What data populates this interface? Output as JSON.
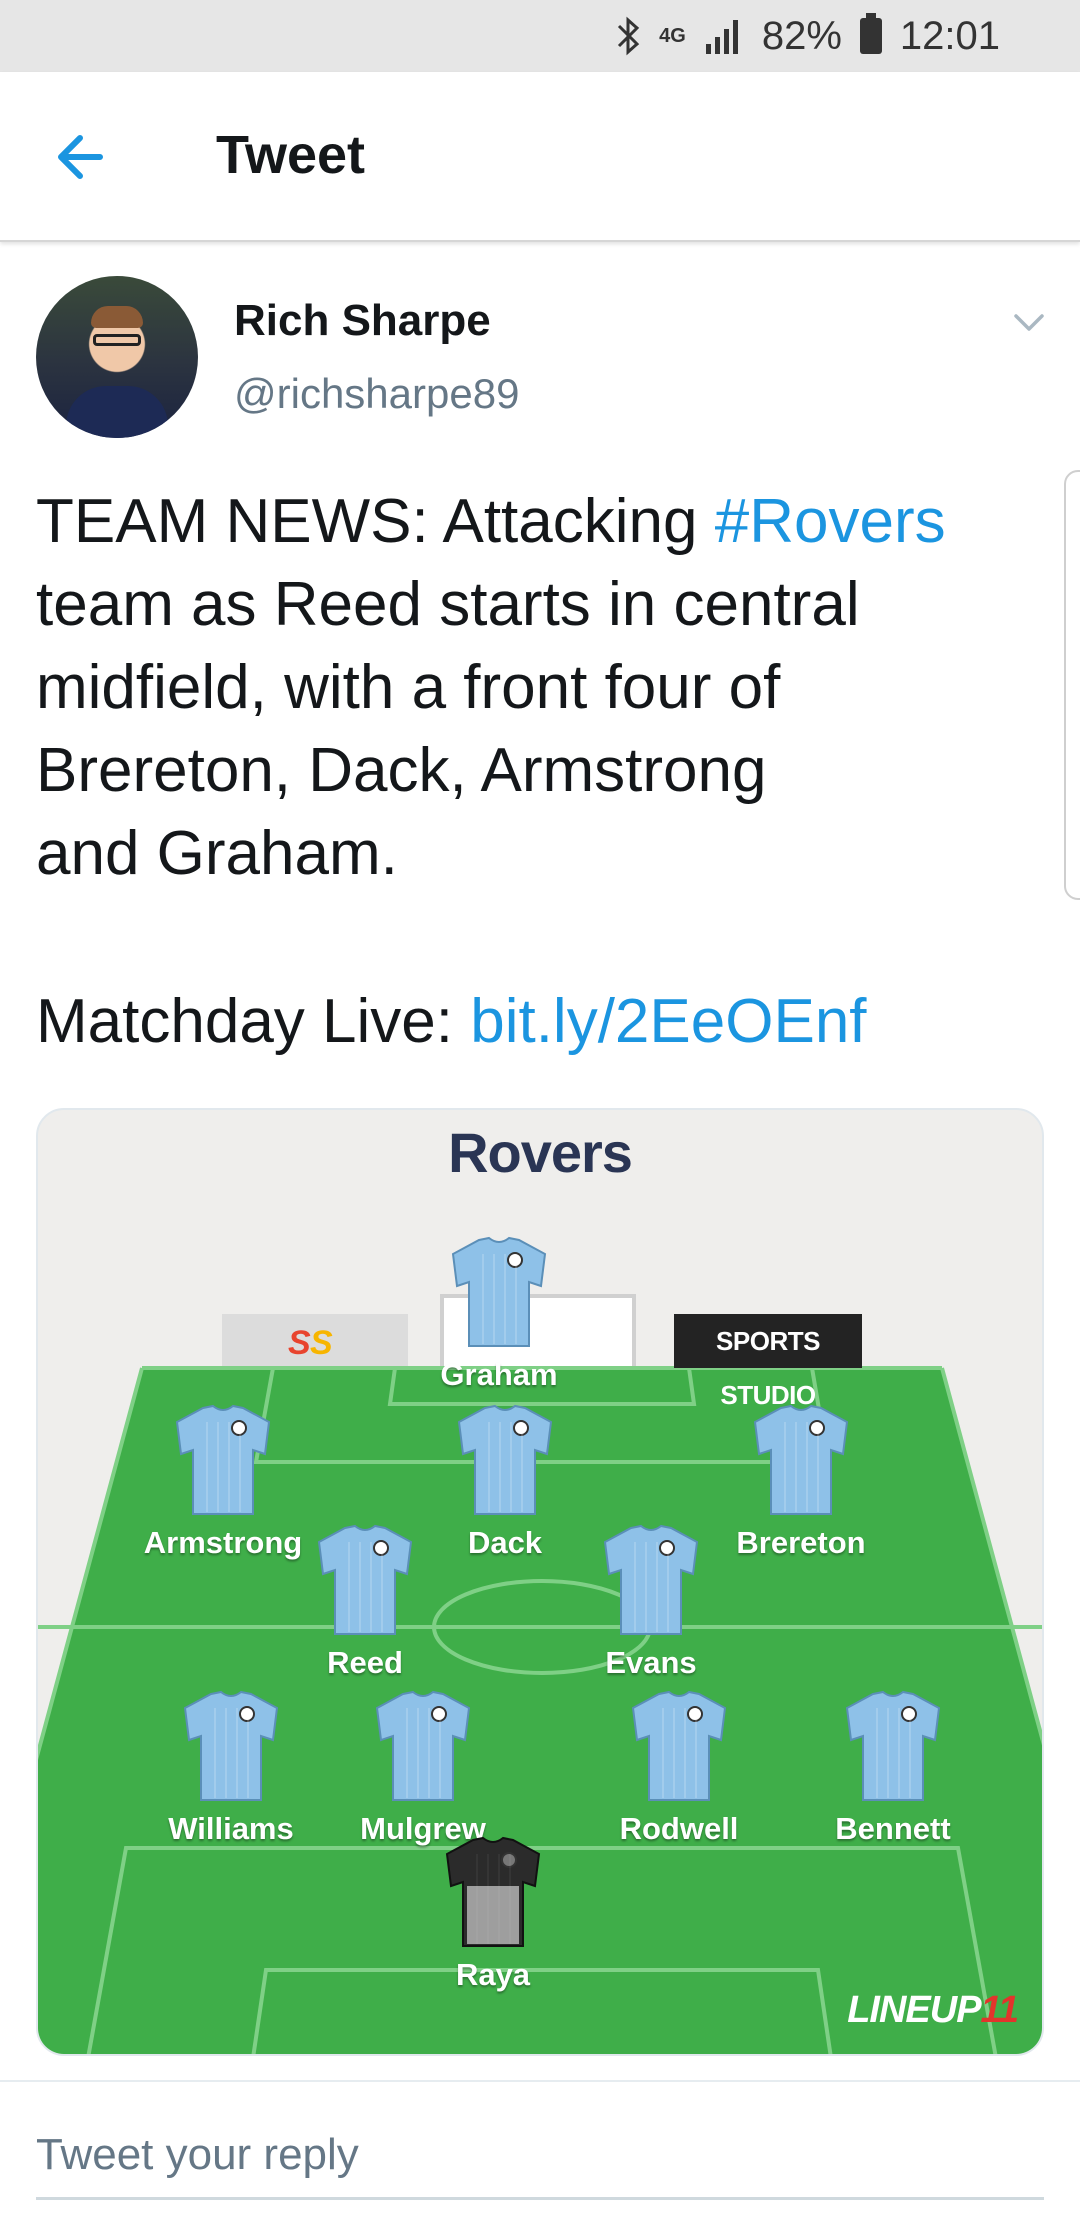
{
  "status_bar": {
    "network": "4G",
    "battery": "82%",
    "time": "12:01"
  },
  "app_bar": {
    "title": "Tweet"
  },
  "tweet": {
    "author_name": "Rich Sharpe",
    "author_handle": "@richsharpe89",
    "text_lines": [
      [
        "TEAM NEWS: Attacking ",
        "#Rovers"
      ],
      [
        "team as Reed starts in central"
      ],
      [
        "midfield, with a front four of"
      ],
      [
        "Brereton, Dack, Armstrong"
      ],
      [
        "and Graham."
      ]
    ],
    "matchday_label": "Matchday Live: ",
    "matchday_link": "bit.ly/2EeOEnf"
  },
  "lineup": {
    "title": "Rovers",
    "sponsor_right": "SPORTS STUDIO",
    "brand": "LINEUP",
    "brand_accent": "11",
    "players": {
      "graham": "Graham",
      "armstrong": "Armstrong",
      "dack": "Dack",
      "brereton": "Brereton",
      "reed": "Reed",
      "evans": "Evans",
      "williams": "Williams",
      "mulgrew": "Mulgrew",
      "rodwell": "Rodwell",
      "bennett": "Bennett",
      "raya": "Raya"
    },
    "colors": {
      "pitch": "#3fae49",
      "shirt": "#8ec1e8",
      "keeper_shirt": "#2b2b2b"
    }
  },
  "reply": {
    "placeholder": "Tweet your reply"
  },
  "colors": {
    "accent": "#1b95e0",
    "text": "#14171a",
    "secondary": "#657786"
  }
}
